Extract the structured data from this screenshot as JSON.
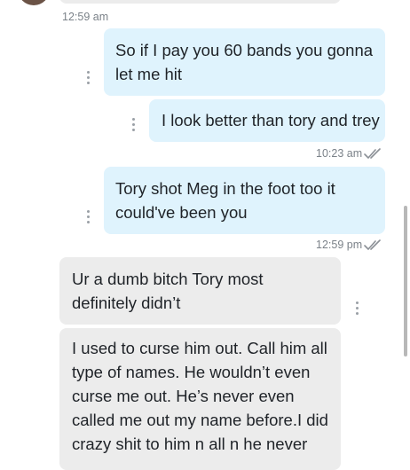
{
  "messages": [
    {
      "type": "outgoing",
      "text": "So if I pay you 60 bands you gonna let me hit"
    },
    {
      "type": "outgoing",
      "text": "I look better than tory and trey"
    },
    {
      "type": "outgoing",
      "text": "Tory shot Meg in the foot too it could've been you"
    },
    {
      "type": "incoming",
      "text": "Ur a dumb bitch Tory most definitely didn’t"
    },
    {
      "type": "incoming",
      "text": "I used to curse him out. Call him all type of names. He wouldn’t even curse me out. He’s never even called me out my name before.I did crazy shit to him n all n he never"
    }
  ],
  "timestamps": {
    "top": "12:59 am",
    "after_msg2": "10:23 am",
    "after_msg3": "12:59 pm"
  },
  "icons": {
    "more": "more-vert-icon",
    "read": "double-check-icon"
  },
  "colors": {
    "outgoing_bubble": "#dff3fd",
    "incoming_bubble": "#ececec"
  }
}
